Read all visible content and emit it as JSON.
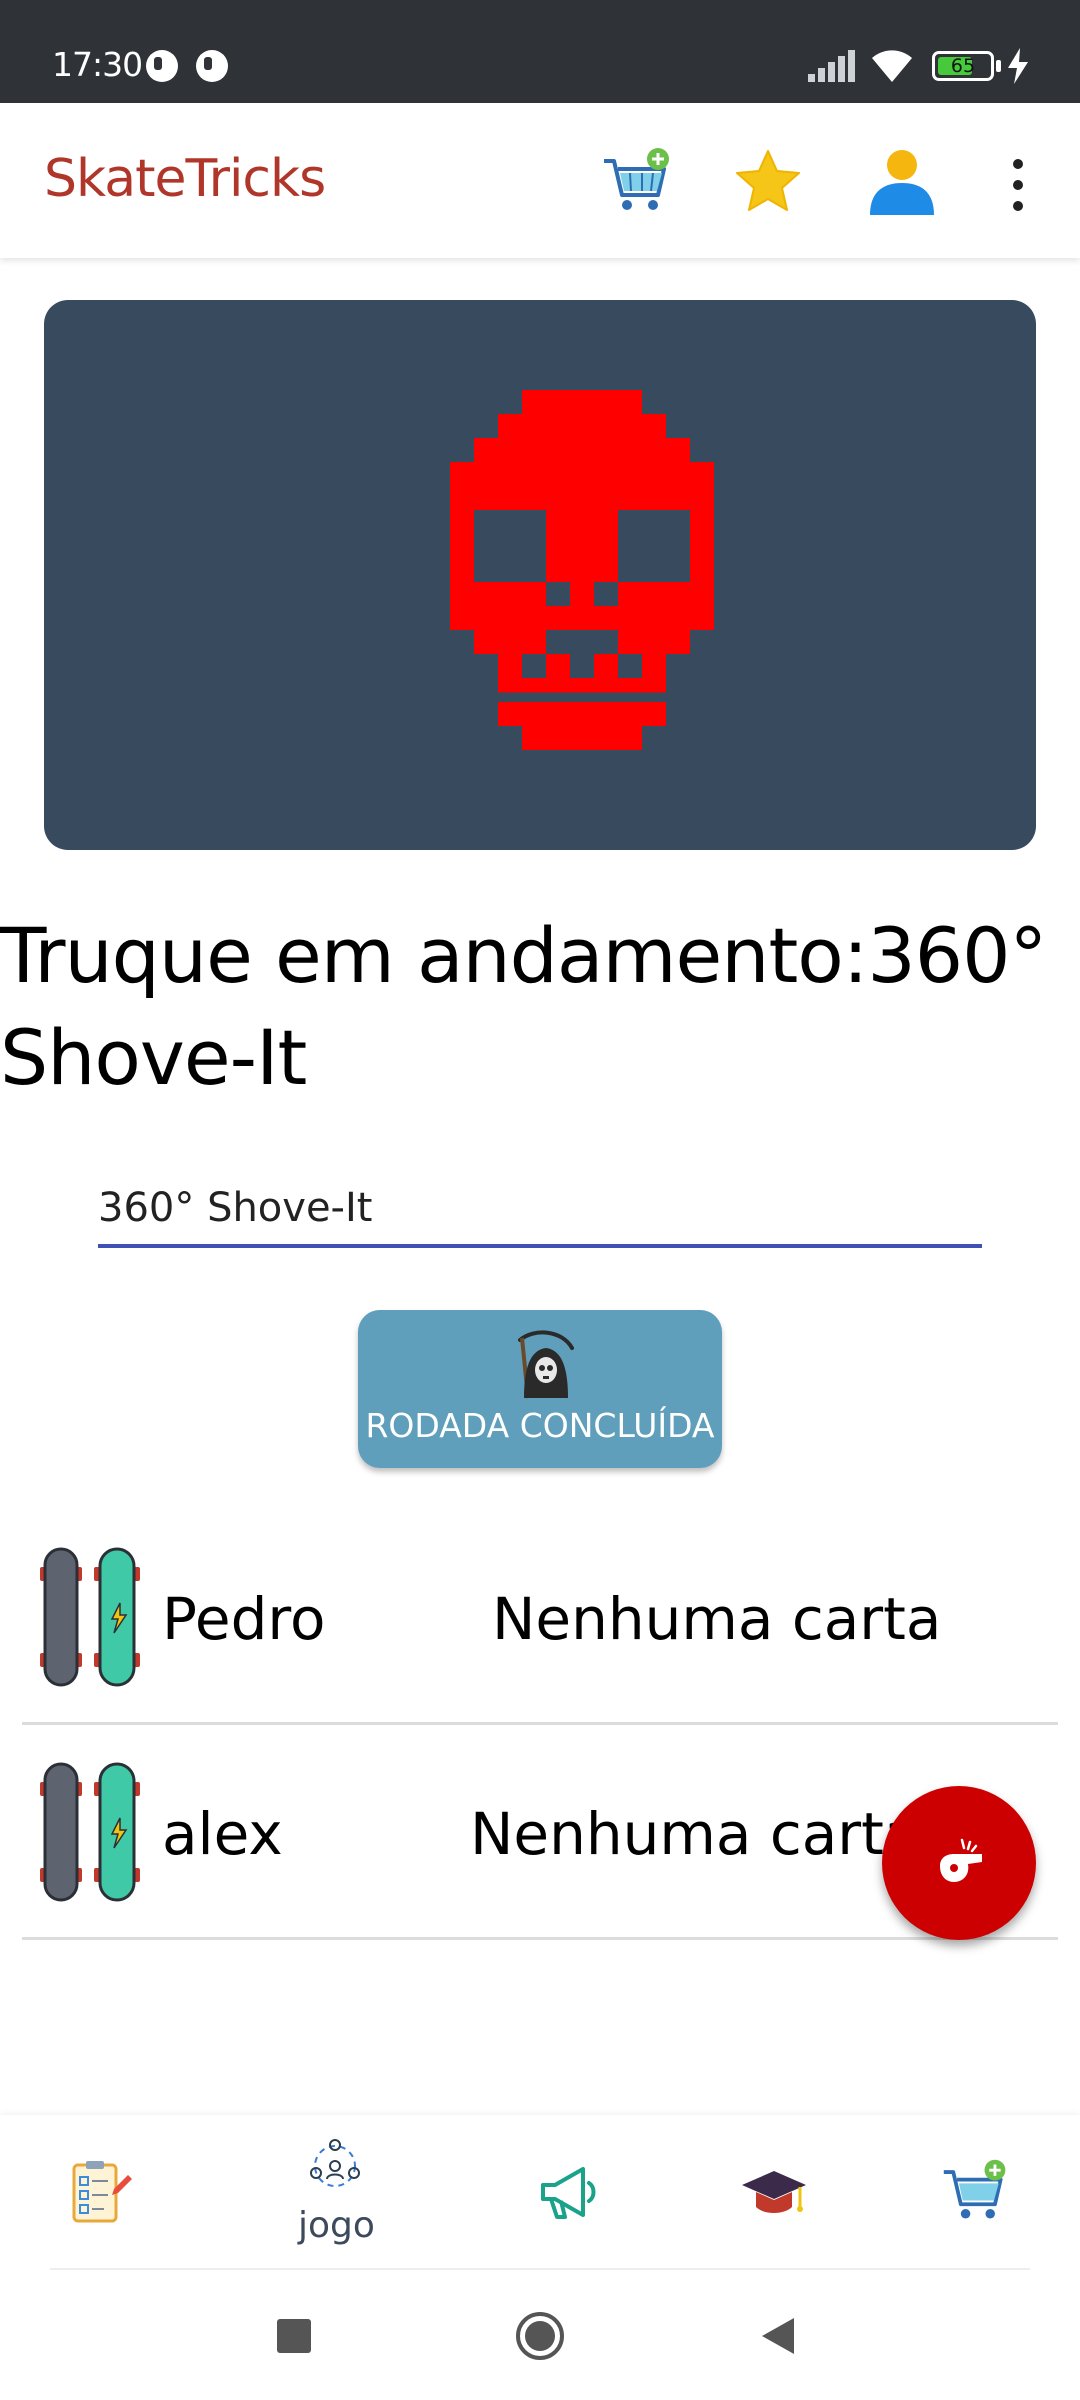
{
  "status_bar": {
    "time": "17:30",
    "battery": "65",
    "icons": [
      "notification-icon",
      "notification-icon",
      "signal-icon",
      "wifi-icon",
      "battery-icon",
      "charging-icon"
    ]
  },
  "app_bar": {
    "title": "SkateTricks",
    "actions": [
      "add-to-cart-icon",
      "star-icon",
      "user-icon",
      "more-vert-icon"
    ]
  },
  "hero": {
    "image": "pixel-skull-icon",
    "background": "#374a5e",
    "skull_color": "#ff0000"
  },
  "trick": {
    "title": "Truque em andamento:360° Shove-It",
    "input_value": "360° Shove-It"
  },
  "round_button": {
    "label": "RODADA CONCLUÍDA",
    "icon": "grim-reaper-icon"
  },
  "players": [
    {
      "name": "Pedro",
      "cards": "Nenhuma carta"
    },
    {
      "name": "alex",
      "cards": "Nenhuma carta"
    }
  ],
  "fab": {
    "icon": "whistle-icon",
    "color": "#cc0000"
  },
  "bottom_nav": {
    "items": [
      {
        "icon": "checklist-icon",
        "label": ""
      },
      {
        "icon": "group-icon",
        "label": "jogo"
      },
      {
        "icon": "megaphone-icon",
        "label": ""
      },
      {
        "icon": "graduation-cap-icon",
        "label": ""
      },
      {
        "icon": "add-to-cart-icon",
        "label": ""
      }
    ]
  },
  "system_nav": [
    "recent-apps-icon",
    "home-icon",
    "back-icon"
  ],
  "colors": {
    "brand": "#b0362a",
    "accent": "#3f51b5",
    "button": "#5f9fbb"
  }
}
